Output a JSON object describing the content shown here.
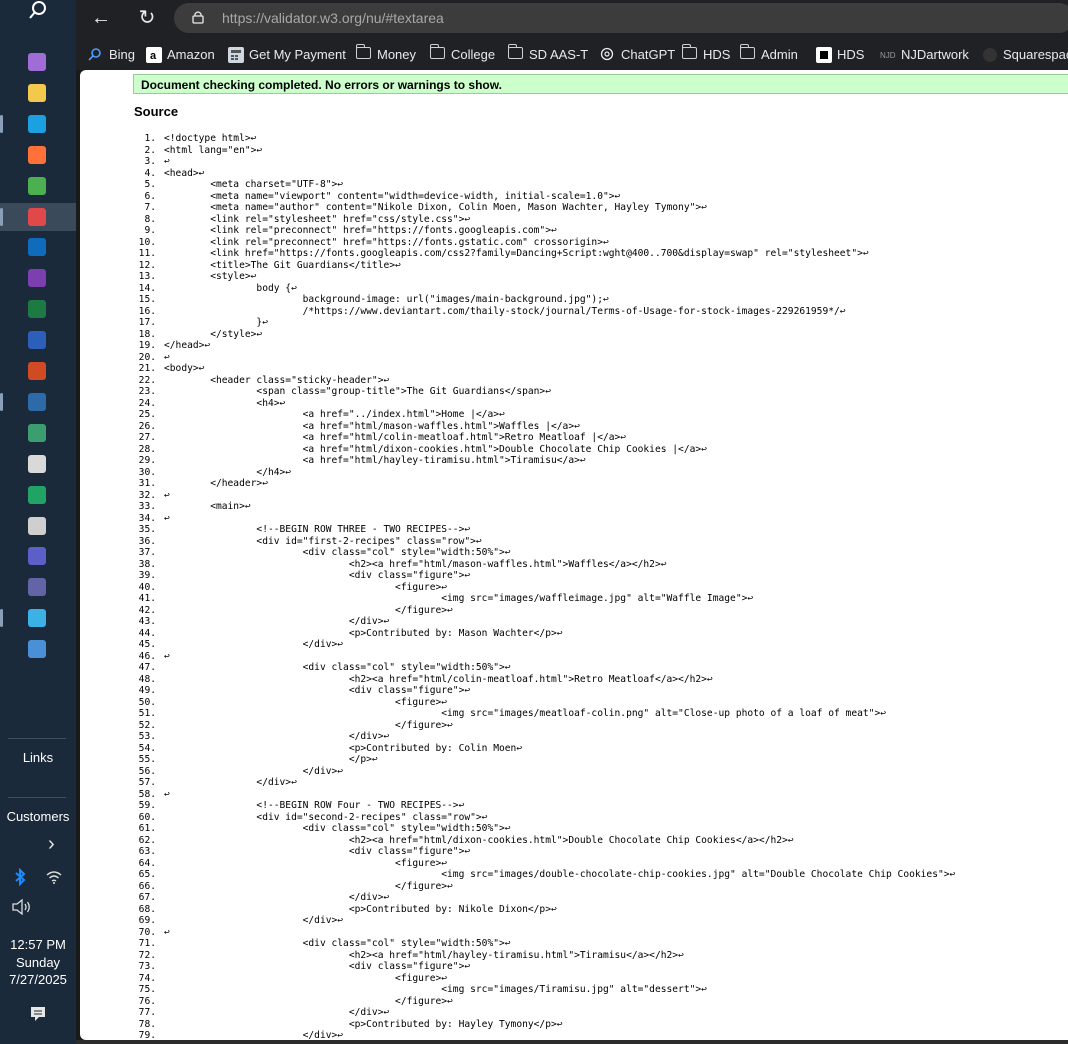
{
  "taskbar": {
    "links_label": "Links",
    "customers_label": "Customers",
    "chevron": "›",
    "time": "12:57 PM",
    "day": "Sunday",
    "date": "7/27/2025",
    "apps": [
      {
        "name": "copilot-icon",
        "color": "#a06cd5"
      },
      {
        "name": "file-explorer-icon",
        "color": "#f2c94c"
      },
      {
        "name": "edge-icon",
        "color": "#1ba1e2"
      },
      {
        "name": "firefox-icon",
        "color": "#ff7139"
      },
      {
        "name": "chrome-icon",
        "color": "#4caf50"
      },
      {
        "name": "paint-icon",
        "color": "#e0484a"
      },
      {
        "name": "outlook-icon",
        "color": "#0f6cbd"
      },
      {
        "name": "onenote-icon",
        "color": "#7b3fb0"
      },
      {
        "name": "excel-icon",
        "color": "#1d7a43"
      },
      {
        "name": "word-icon",
        "color": "#2b5fb9"
      },
      {
        "name": "powerpoint-icon",
        "color": "#d04a23"
      },
      {
        "name": "solitaire-icon",
        "color": "#2d6aa8"
      },
      {
        "name": "solitaire-collection-icon",
        "color": "#3b9e6f"
      },
      {
        "name": "puzzle-icon",
        "color": "#d9d9d9"
      },
      {
        "name": "green-circle-app-icon",
        "color": "#21a366"
      },
      {
        "name": "calculator-icon",
        "color": "#cfcfcf"
      },
      {
        "name": "teams-icon",
        "color": "#5b5fc7"
      },
      {
        "name": "teams-classic-icon",
        "color": "#6264a7"
      },
      {
        "name": "notepad-icon",
        "color": "#3bb1e6"
      },
      {
        "name": "settings-app-icon",
        "color": "#4a90d9"
      }
    ]
  },
  "browser": {
    "back": "←",
    "reload": "↻",
    "url_host": "https://validator.w3.org",
    "url_path": "/nu/#textarea",
    "bookmarks": [
      {
        "label": "Bing",
        "icon": "bing-search-icon"
      },
      {
        "label": "Amazon",
        "icon": "amazon-icon"
      },
      {
        "label": "Get My Payment",
        "icon": "calculator-bookmark-icon"
      },
      {
        "label": "Money",
        "icon": "folder-icon"
      },
      {
        "label": "College",
        "icon": "folder-icon"
      },
      {
        "label": "SD AAS-T",
        "icon": "folder-icon"
      },
      {
        "label": "ChatGPT",
        "icon": "chatgpt-icon"
      },
      {
        "label": "HDS",
        "icon": "folder-icon"
      },
      {
        "label": "Admin",
        "icon": "folder-icon"
      },
      {
        "label": "HDS",
        "icon": "hds-square-icon"
      },
      {
        "label": "NJDartwork",
        "icon": "njd-icon"
      },
      {
        "label": "Squarespace",
        "icon": "squarespace-icon"
      }
    ]
  },
  "validator": {
    "success_message": "Document checking completed. No errors or warnings to show.",
    "source_heading": "Source"
  },
  "source_lines": [
    "<!doctype html>↩",
    "<html lang=\"en\">↩",
    "↩",
    "<head>↩",
    "        <meta charset=\"UTF-8\">↩",
    "        <meta name=\"viewport\" content=\"width=device-width, initial-scale=1.0\">↩",
    "        <meta name=\"author\" content=\"Nikole Dixon, Colin Moen, Mason Wachter, Hayley Tymony\">↩",
    "        <link rel=\"stylesheet\" href=\"css/style.css\">↩",
    "        <link rel=\"preconnect\" href=\"https://fonts.googleapis.com\">↩",
    "        <link rel=\"preconnect\" href=\"https://fonts.gstatic.com\" crossorigin>↩",
    "        <link href=\"https://fonts.googleapis.com/css2?family=Dancing+Script:wght@400..700&display=swap\" rel=\"stylesheet\">↩",
    "        <title>The Git Guardians</title>↩",
    "        <style>↩",
    "                body {↩",
    "                        background-image: url(\"images/main-background.jpg\");↩",
    "                        /*https://www.deviantart.com/thaily-stock/journal/Terms-of-Usage-for-stock-images-229261959*/↩",
    "                }↩",
    "        </style>↩",
    "</head>↩",
    "↩",
    "<body>↩",
    "        <header class=\"sticky-header\">↩",
    "                <span class=\"group-title\">The Git Guardians</span>↩",
    "                <h4>↩",
    "                        <a href=\"../index.html\">Home |</a>↩",
    "                        <a href=\"html/mason-waffles.html\">Waffles |</a>↩",
    "                        <a href=\"html/colin-meatloaf.html\">Retro Meatloaf |</a>↩",
    "                        <a href=\"html/dixon-cookies.html\">Double Chocolate Chip Cookies |</a>↩",
    "                        <a href=\"html/hayley-tiramisu.html\">Tiramisu</a>↩",
    "                </h4>↩",
    "        </header>↩",
    "↩",
    "        <main>↩",
    "↩",
    "                <!--BEGIN ROW THREE - TWO RECIPES-->↩",
    "                <div id=\"first-2-recipes\" class=\"row\">↩",
    "                        <div class=\"col\" style=\"width:50%\">↩",
    "                                <h2><a href=\"html/mason-waffles.html\">Waffles</a></h2>↩",
    "                                <div class=\"figure\">↩",
    "                                        <figure>↩",
    "                                                <img src=\"images/waffleimage.jpg\" alt=\"Waffle Image\">↩",
    "                                        </figure>↩",
    "                                </div>↩",
    "                                <p>Contributed by: Mason Wachter</p>↩",
    "                        </div>↩",
    "↩",
    "                        <div class=\"col\" style=\"width:50%\">↩",
    "                                <h2><a href=\"html/colin-meatloaf.html\">Retro Meatloaf</a></h2>↩",
    "                                <div class=\"figure\">↩",
    "                                        <figure>↩",
    "                                                <img src=\"images/meatloaf-colin.png\" alt=\"Close-up photo of a loaf of meat\">↩",
    "                                        </figure>↩",
    "                                </div>↩",
    "                                <p>Contributed by: Colin Moen↩",
    "                                </p>↩",
    "                        </div>↩",
    "                </div>↩",
    "↩",
    "                <!--BEGIN ROW Four - TWO RECIPES-->↩",
    "                <div id=\"second-2-recipes\" class=\"row\">↩",
    "                        <div class=\"col\" style=\"width:50%\">↩",
    "                                <h2><a href=\"html/dixon-cookies.html\">Double Chocolate Chip Cookies</a></h2>↩",
    "                                <div class=\"figure\">↩",
    "                                        <figure>↩",
    "                                                <img src=\"images/double-chocolate-chip-cookies.jpg\" alt=\"Double Chocolate Chip Cookies\">↩",
    "                                        </figure>↩",
    "                                </div>↩",
    "                                <p>Contributed by: Nikole Dixon</p>↩",
    "                        </div>↩",
    "↩",
    "                        <div class=\"col\" style=\"width:50%\">↩",
    "                                <h2><a href=\"html/hayley-tiramisu.html\">Tiramisu</a></h2>↩",
    "                                <div class=\"figure\">↩",
    "                                        <figure>↩",
    "                                                <img src=\"images/Tiramisu.jpg\" alt=\"dessert\">↩",
    "                                        </figure>↩",
    "                                </div>↩",
    "                                <p>Contributed by: Hayley Tymony</p>↩",
    "                        </div>↩"
  ]
}
